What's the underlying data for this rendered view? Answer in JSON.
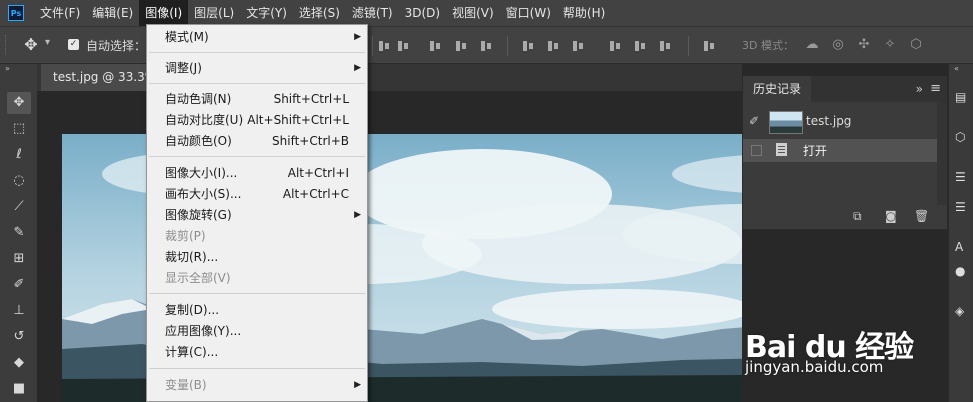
{
  "app": {
    "logo": "Ps"
  },
  "menubar": {
    "items": [
      "文件(F)",
      "编辑(E)",
      "图像(I)",
      "图层(L)",
      "文字(Y)",
      "选择(S)",
      "滤镜(T)",
      "3D(D)",
      "视图(V)",
      "窗口(W)",
      "帮助(H)"
    ],
    "active": "图像(I)"
  },
  "options": {
    "auto_select_label": "自动选择：",
    "mode_3d_label": "3D 模式："
  },
  "document": {
    "tab_label": "test.jpg @ 33.3%("
  },
  "image_menu": {
    "items": [
      {
        "label": "模式(M)",
        "shortcut": "",
        "submenu": true,
        "disabled": false
      },
      {
        "label": "调整(J)",
        "shortcut": "",
        "submenu": true,
        "disabled": false
      },
      {
        "label": "自动色调(N)",
        "shortcut": "Shift+Ctrl+L",
        "submenu": false,
        "disabled": false
      },
      {
        "label": "自动对比度(U)",
        "shortcut": "Alt+Shift+Ctrl+L",
        "submenu": false,
        "disabled": false
      },
      {
        "label": "自动颜色(O)",
        "shortcut": "Shift+Ctrl+B",
        "submenu": false,
        "disabled": false
      },
      {
        "label": "图像大小(I)...",
        "shortcut": "Alt+Ctrl+I",
        "submenu": false,
        "disabled": false
      },
      {
        "label": "画布大小(S)...",
        "shortcut": "Alt+Ctrl+C",
        "submenu": false,
        "disabled": false
      },
      {
        "label": "图像旋转(G)",
        "shortcut": "",
        "submenu": true,
        "disabled": false
      },
      {
        "label": "裁剪(P)",
        "shortcut": "",
        "submenu": false,
        "disabled": true
      },
      {
        "label": "裁切(R)...",
        "shortcut": "",
        "submenu": false,
        "disabled": false
      },
      {
        "label": "显示全部(V)",
        "shortcut": "",
        "submenu": false,
        "disabled": true
      },
      {
        "label": "复制(D)...",
        "shortcut": "",
        "submenu": false,
        "disabled": false
      },
      {
        "label": "应用图像(Y)...",
        "shortcut": "",
        "submenu": false,
        "disabled": false
      },
      {
        "label": "计算(C)...",
        "shortcut": "",
        "submenu": false,
        "disabled": false
      },
      {
        "label": "变量(B)",
        "shortcut": "",
        "submenu": true,
        "disabled": true
      }
    ]
  },
  "history_panel": {
    "title": "历史记录",
    "snapshot_name": "test.jpg",
    "states": [
      "打开"
    ]
  },
  "watermark": {
    "brand": "Bai du 经验",
    "url": "jingyan.baidu.com"
  }
}
